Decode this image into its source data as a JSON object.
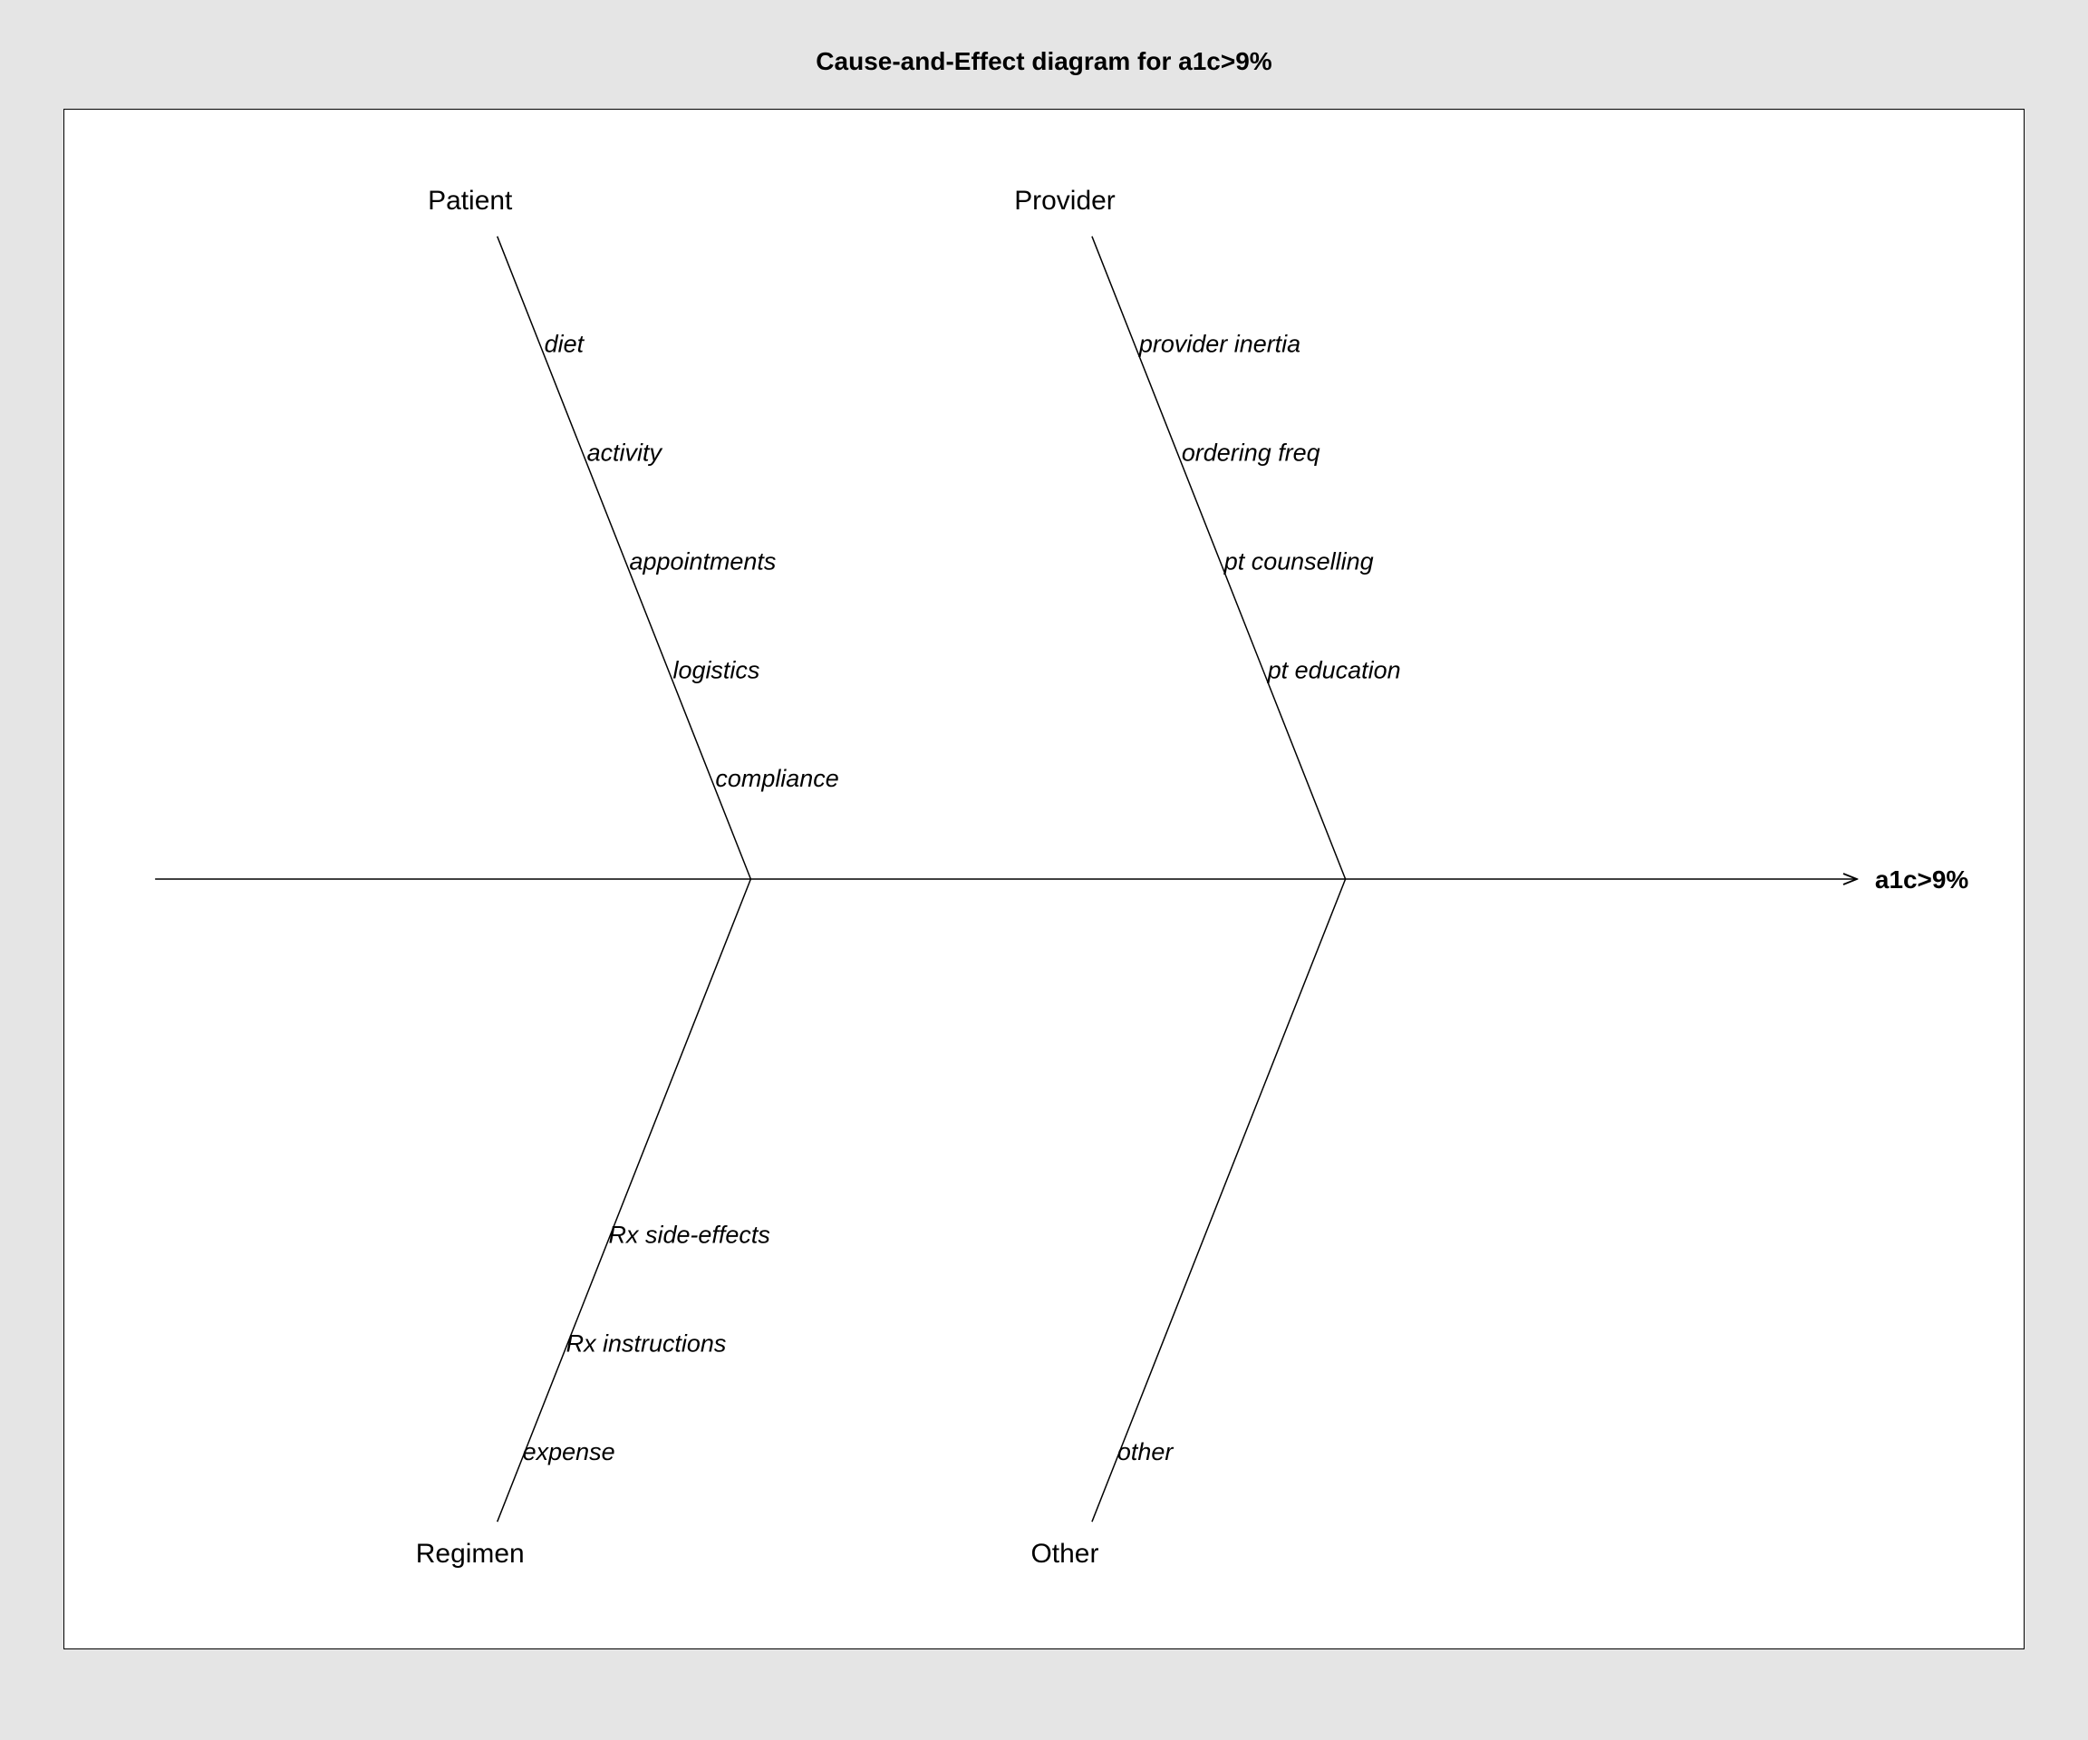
{
  "chart_data": {
    "type": "fishbone",
    "title": "Cause-and-Effect diagram for a1c>9%",
    "effect": "a1c>9%",
    "categories": [
      {
        "name": "Patient",
        "position": "top",
        "causes": [
          "diet",
          "activity",
          "appointments",
          "logistics",
          "compliance"
        ]
      },
      {
        "name": "Provider",
        "position": "top",
        "causes": [
          "provider inertia",
          "ordering freq",
          "pt counselling",
          "pt education"
        ]
      },
      {
        "name": "Regimen",
        "position": "bottom",
        "causes": [
          "Rx side-effects",
          "Rx instructions",
          "expense"
        ]
      },
      {
        "name": "Other",
        "position": "bottom",
        "causes": [
          "other"
        ]
      }
    ]
  }
}
